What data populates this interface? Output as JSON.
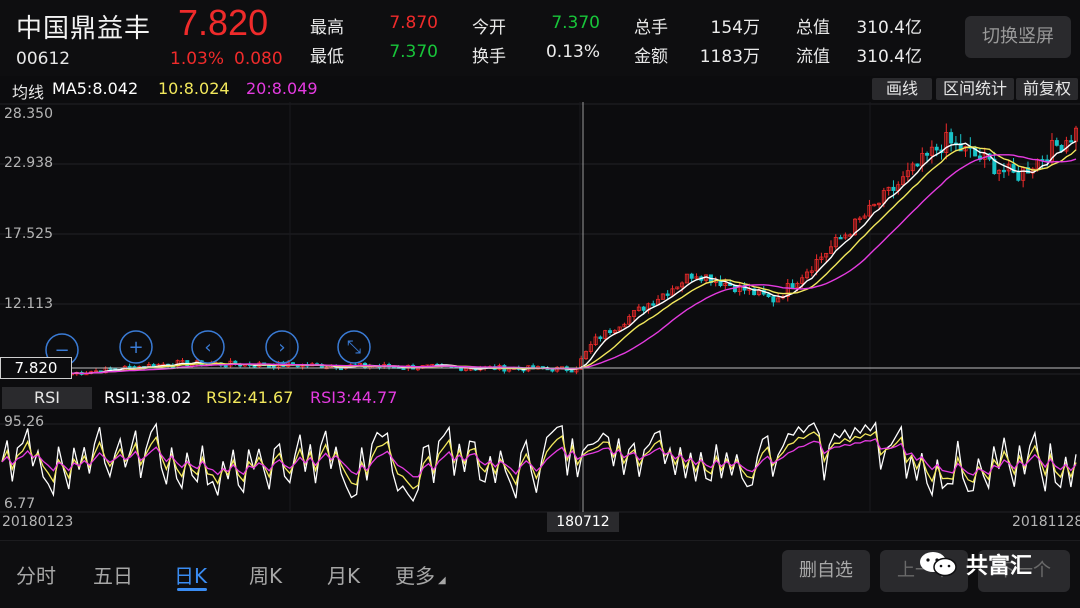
{
  "stock": {
    "name": "中国鼎益丰",
    "code": "00612",
    "price": "7.820",
    "change_pct": "1.03%",
    "change_amt": "0.080"
  },
  "quote": {
    "high_label": "最高",
    "high": "7.870",
    "low_label": "最低",
    "low": "7.370",
    "open_label": "今开",
    "open": "7.370",
    "turnover_label": "换手",
    "turnover": "0.13%",
    "volume_label": "总手",
    "volume": "154万",
    "amount_label": "金额",
    "amount": "1183万",
    "mktcap_label": "总值",
    "mktcap": "310.4亿",
    "float_label": "流值",
    "float_cap": "310.4亿"
  },
  "switch_button": "切换竖屏",
  "ma": {
    "label": "均线",
    "ma5": "MA5:8.042",
    "ma10": "10:8.024",
    "ma20": "20:8.049"
  },
  "tools": {
    "draw": "画线",
    "range_stats": "区间统计",
    "adjust": "前复权"
  },
  "price_axis": [
    "28.350",
    "22.938",
    "17.525",
    "12.113"
  ],
  "current_price_tag": "7.820",
  "rsi": {
    "tab": "RSI",
    "rsi1": "RSI1:38.02",
    "rsi2": "RSI2:41.67",
    "rsi3": "RSI3:44.77",
    "axis_high": "95.26",
    "axis_low": "6.77"
  },
  "dates": {
    "start": "20180123",
    "cross": "180712",
    "end": "20181128"
  },
  "tabs": [
    "分时",
    "五日",
    "日K",
    "周K",
    "月K",
    "更多"
  ],
  "active_tab": 2,
  "actions": {
    "remove_watch": "删自选",
    "prev": "上一个",
    "next": "下一个"
  },
  "brand": "共富汇",
  "colors": {
    "up": "#ef2b2b",
    "down": "#18c53a",
    "ma5": "#ffffff",
    "ma10": "#f2e85c",
    "ma20": "#e43be0",
    "accent": "#3a8cf2"
  }
}
